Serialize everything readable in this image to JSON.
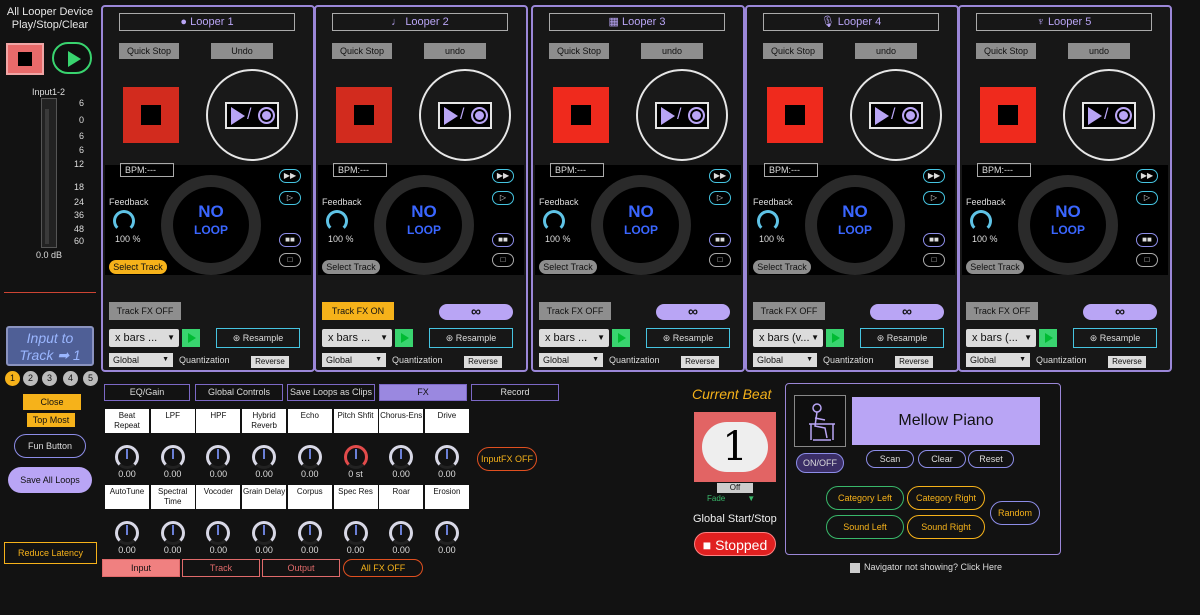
{
  "global": {
    "title": "All Looper Device Play/Stop/Clear",
    "input_label": "Input1-2",
    "meter_ticks": [
      "6",
      "0",
      "6",
      "6",
      "12",
      "18",
      "24",
      "36",
      "48",
      "60"
    ],
    "db_value": "0.0 dB",
    "input_to_track": "Input to Track ➡ 1",
    "track_numbers": [
      "1",
      "2",
      "3",
      "4",
      "5"
    ],
    "close": "Close",
    "top_most": "Top Most",
    "fun_button": "Fun Button",
    "save_all": "Save All Loops",
    "reduce_latency": "Reduce Latency"
  },
  "loopers": [
    {
      "name": "Looper 1",
      "icon": "●",
      "undo": "Undo",
      "select_highlight": true,
      "track_fx": "Track FX OFF",
      "track_fx_on": false,
      "show_inf": false,
      "bars": "x bars ..."
    },
    {
      "name": "Looper 2",
      "icon": "♩",
      "undo": "undo",
      "select_highlight": false,
      "track_fx": "Track FX ON",
      "track_fx_on": true,
      "show_inf": true,
      "bars": "x bars ..."
    },
    {
      "name": "Looper 3",
      "icon": "▦",
      "undo": "undo",
      "select_highlight": false,
      "track_fx": "Track FX OFF",
      "track_fx_on": false,
      "show_inf": true,
      "bars": "x bars ..."
    },
    {
      "name": "Looper 4",
      "icon": "🎙",
      "undo": "undo",
      "select_highlight": false,
      "track_fx": "Track FX OFF",
      "track_fx_on": false,
      "show_inf": true,
      "bars": "x bars (v..."
    },
    {
      "name": "Looper 5",
      "icon": "♆",
      "undo": "undo",
      "select_highlight": false,
      "track_fx": "Track FX OFF",
      "track_fx_on": false,
      "show_inf": true,
      "bars": "x bars (..."
    }
  ],
  "looper_common": {
    "quick_stop": "Quick Stop",
    "bpm": "BPM:---",
    "feedback": "Feedback",
    "feedback_value": "100 %",
    "no_loop_1": "NO",
    "no_loop_2": "LOOP",
    "select_track": "Select Track",
    "infinity": "∞",
    "resample": "⊛ Resample",
    "global": "Global",
    "quantization": "Quantization",
    "reverse": "Reverse",
    "side_ff": "▶▶",
    "side_play": "▷",
    "side_dots": "■■",
    "side_sq": "□"
  },
  "tabs": [
    "EQ/Gain",
    "Global Controls",
    "Save Loops as Clips",
    "FX",
    "Record"
  ],
  "fx_row1": [
    {
      "name": "Beat Repeat",
      "value": "0.00"
    },
    {
      "name": "LPF",
      "value": "0.00"
    },
    {
      "name": "HPF",
      "value": "0.00"
    },
    {
      "name": "Hybrid Reverb",
      "value": "0.00"
    },
    {
      "name": "Echo",
      "value": "0.00"
    },
    {
      "name": "Pitch Shfit",
      "value": "0 st"
    },
    {
      "name": "Chorus-Ens",
      "value": "0.00"
    },
    {
      "name": "Drive",
      "value": "0.00"
    }
  ],
  "fx_row2": [
    {
      "name": "AutoTune",
      "value": "0.00"
    },
    {
      "name": "Spectral Time",
      "value": "0.00"
    },
    {
      "name": "Vocoder",
      "value": "0.00"
    },
    {
      "name": "Grain Delay",
      "value": "0.00"
    },
    {
      "name": "Corpus",
      "value": "0.00"
    },
    {
      "name": "Spec Res",
      "value": "0.00"
    },
    {
      "name": "Roar",
      "value": "0.00"
    },
    {
      "name": "Erosion",
      "value": "0.00"
    }
  ],
  "input_fx_off": "InputFX OFF",
  "bottom_tabs": [
    "Input",
    "Track",
    "Output",
    "All FX OFF"
  ],
  "beat": {
    "label": "Current Beat",
    "value": "1",
    "off": "Off",
    "fade": "Fade",
    "global_start_stop": "Global Start/Stop",
    "stopped": "■ Stopped"
  },
  "navigator": {
    "instrument": "Mellow Piano",
    "on_off": "ON/OFF",
    "scan": "Scan",
    "clear": "Clear",
    "reset": "Reset",
    "category_left": "Category Left",
    "category_right": "Category Right",
    "sound_left": "Sound Left",
    "sound_right": "Sound Right",
    "random": "Random",
    "note": "Navigator not showing? Click Here"
  }
}
